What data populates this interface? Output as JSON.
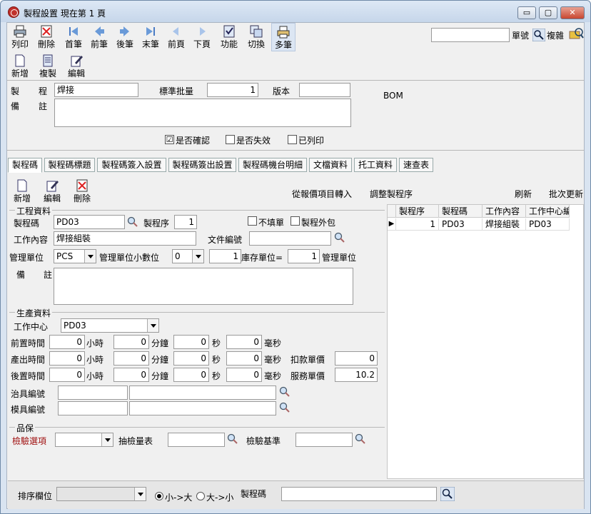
{
  "window": {
    "title": "製程設置 現在第 1 頁",
    "min": "▭",
    "max": "▢",
    "close": "✕"
  },
  "toolbar": {
    "print": "列印",
    "delete": "刪除",
    "first": "首筆",
    "prev": "前筆",
    "next": "後筆",
    "last": "末筆",
    "prev_page": "前頁",
    "next_page": "下頁",
    "function": "功能",
    "switch": "切換",
    "multi": "多筆",
    "new": "新增",
    "copy": "複製",
    "edit": "編輯",
    "doc_no_label": "單號",
    "doc_no_value": "",
    "complex": "複雜"
  },
  "header": {
    "process_label1": "製",
    "process_label2": "程",
    "process_value": "焊接",
    "std_batch_label": "標準批量",
    "std_batch_value": "1",
    "version_label": "版本",
    "version_value": "",
    "remark_label1": "備",
    "remark_label2": "註",
    "remark_value": "",
    "bom": "BOM",
    "confirmed": "是否確認",
    "invalid": "是否失效",
    "printed": "已列印",
    "confirmed_checked": "☑"
  },
  "tabs": [
    "製程碼",
    "製程碼標題",
    "製程碼簽入設置",
    "製程碼簽出設置",
    "製程碼機台明細",
    "文檔資料",
    "托工資料",
    "速查表"
  ],
  "subtoolbar": {
    "new": "新增",
    "edit": "編輯",
    "delete": "刪除",
    "import": "從報價項目轉入",
    "adjust": "調整製程序",
    "refresh": "刷新",
    "batch_update": "批次更新"
  },
  "process_info": {
    "section": "工程資料",
    "code_label": "製程碼",
    "code_value": "PD03",
    "seq_label": "製程序",
    "seq_value": "1",
    "no_fill": "不填單",
    "outsource": "製程外包",
    "content_label": "工作內容",
    "content_value": "焊接組裝",
    "doc_label": "文件編號",
    "doc_value": "",
    "unit_label": "管理單位",
    "unit_value": "PCS",
    "unit_dec_label": "管理單位小數位",
    "unit_dec_value": "0",
    "ratio1": "1",
    "stock_unit_label": "庫存單位=",
    "ratio2": "1",
    "mgmt_unit_label": "管理單位",
    "remark_label1": "備",
    "remark_label2": "註",
    "remark_value": ""
  },
  "production": {
    "section": "生產資料",
    "center_label": "工作中心",
    "center_value": "PD03",
    "pre_label": "前置時間",
    "out_label": "產出時間",
    "post_label": "後置時間",
    "hour": "小時",
    "min": "分鐘",
    "sec": "秒",
    "ms": "毫秒",
    "zero": "0",
    "deduct_label": "扣款單價",
    "deduct_value": "0",
    "service_label": "服務單價",
    "service_value": "10.2",
    "jig_label": "治具編號",
    "mold_label": "模具編號"
  },
  "quality": {
    "section": "品保",
    "inspect_option": "檢驗選項",
    "sampling": "抽檢量表",
    "standard": "檢驗基準"
  },
  "grid": {
    "headers": [
      "製程序",
      "製程碼",
      "工作內容",
      "工作中心編"
    ],
    "rows": [
      [
        "1",
        "PD03",
        "焊接組裝",
        "PD03"
      ]
    ]
  },
  "footer": {
    "sort_label": "排序欄位",
    "asc": "小->大",
    "desc": "大->小",
    "code_label": "製程碼",
    "code_value": ""
  }
}
